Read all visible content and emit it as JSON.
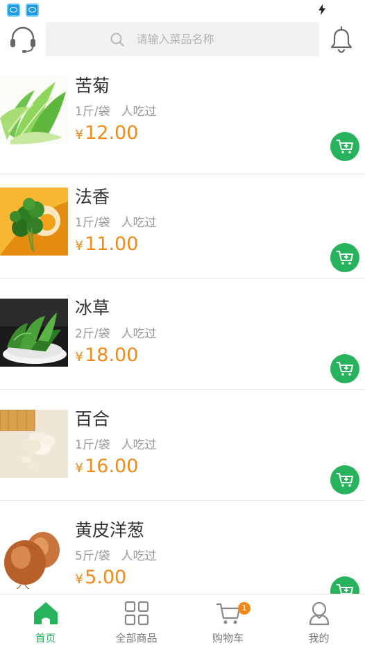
{
  "status_bar": {
    "icons": [
      "app-notification-icon",
      "app-notification-icon",
      "charging-bolt-icon"
    ]
  },
  "header": {
    "left_icon": "headset-customer-service-icon",
    "search_placeholder": "请输入菜品名称",
    "right_icon": "bell-notification-icon"
  },
  "products": [
    {
      "name": "苦菊",
      "spec": "1斤/袋",
      "eaten_label": "人吃过",
      "currency": "¥",
      "price": "12.00",
      "image": "frisee-endive-photo"
    },
    {
      "name": "法香",
      "spec": "1斤/袋",
      "eaten_label": "人吃过",
      "currency": "¥",
      "price": "11.00",
      "image": "parsley-photo"
    },
    {
      "name": "冰草",
      "spec": "2斤/袋",
      "eaten_label": "人吃过",
      "currency": "¥",
      "price": "18.00",
      "image": "ice-plant-photo"
    },
    {
      "name": "百合",
      "spec": "1斤/袋",
      "eaten_label": "人吃过",
      "currency": "¥",
      "price": "16.00",
      "image": "lily-bulb-photo"
    },
    {
      "name": "黄皮洋葱",
      "spec": "5斤/袋",
      "eaten_label": "人吃过",
      "currency": "¥",
      "price": "5.00",
      "image": "yellow-onion-photo"
    }
  ],
  "add_to_cart_icon": "cart-plus-icon",
  "tabs": [
    {
      "label": "首页",
      "icon": "home-icon",
      "active": true
    },
    {
      "label": "全部商品",
      "icon": "grid-icon",
      "active": false
    },
    {
      "label": "购物车",
      "icon": "cart-icon",
      "active": false,
      "badge": "1"
    },
    {
      "label": "我的",
      "icon": "user-icon",
      "active": false
    }
  ],
  "colors": {
    "accent_green": "#27b35b",
    "price_orange": "#f08a17",
    "badge_orange": "#f08a17",
    "search_bg": "#f2f2f2"
  }
}
